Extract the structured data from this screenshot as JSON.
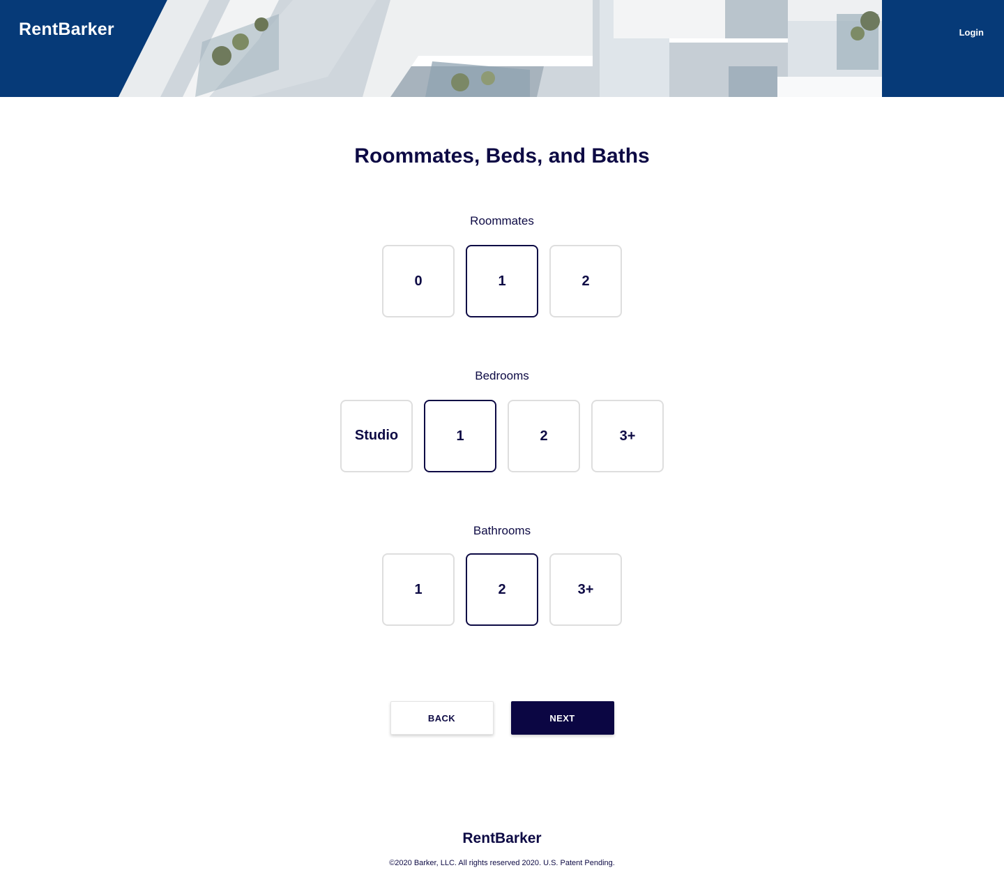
{
  "header": {
    "brand": "RentBarker",
    "login_label": "Login"
  },
  "main": {
    "title": "Roommates, Beds, and Baths",
    "roommates": {
      "label": "Roommates",
      "options": [
        "0",
        "1",
        "2"
      ],
      "selected": "1"
    },
    "bedrooms": {
      "label": "Bedrooms",
      "options": [
        "Studio",
        "1",
        "2",
        "3+"
      ],
      "selected": "1"
    },
    "bathrooms": {
      "label": "Bathrooms",
      "options": [
        "1",
        "2",
        "3+"
      ],
      "selected": "2"
    }
  },
  "actions": {
    "back_label": "BACK",
    "next_label": "NEXT"
  },
  "footer": {
    "brand": "RentBarker",
    "copyright": "©2020 Barker, LLC. All rights reserved 2020. U.S. Patent Pending."
  },
  "colors": {
    "header_bg": "#063a78",
    "primary_text": "#0d0a44",
    "next_button_bg": "#0b0643",
    "option_border": "#dedede"
  }
}
